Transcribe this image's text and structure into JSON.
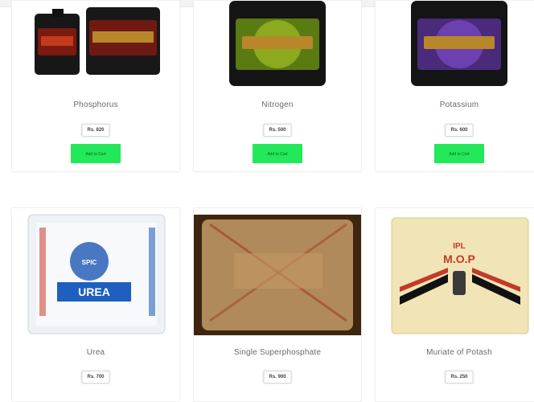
{
  "products": [
    {
      "name": "Phosphorus",
      "price": "Rs. 820",
      "button": "Add to Cart",
      "image": "phosphorus-bottles"
    },
    {
      "name": "Nitrogen",
      "price": "Rs. 500",
      "button": "Add to Cart",
      "image": "nitrogen-bottle"
    },
    {
      "name": "Potassium",
      "price": "Rs. 600",
      "button": "Add to Cart",
      "image": "potassium-bottle"
    },
    {
      "name": "Urea",
      "price": "Rs. 700",
      "image": "urea-bag",
      "bag_text": {
        "brand": "SPIC",
        "product": "UREA"
      }
    },
    {
      "name": "Single Superphosphate",
      "price": "Rs. 900",
      "image": "ssp-sack"
    },
    {
      "name": "Muriate of Potash",
      "price": "Rs. 250",
      "image": "mop-bag",
      "bag_text": {
        "brand": "IPL",
        "product": "M.O.P"
      }
    }
  ],
  "colors": {
    "button": "#22e85a",
    "card_border": "#f0f0f0"
  }
}
